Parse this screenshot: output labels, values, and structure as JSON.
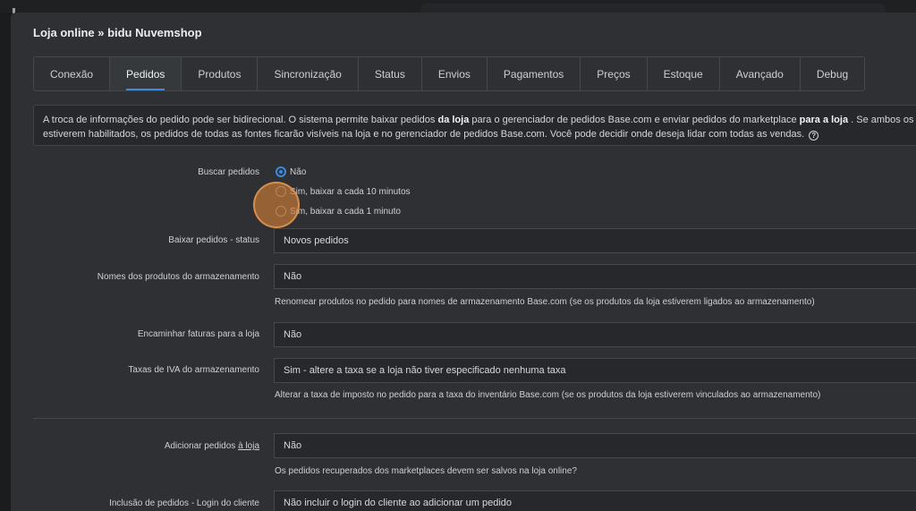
{
  "modal": {
    "title": "Loja online » bidu Nuvemshop"
  },
  "tabs": [
    {
      "label": "Conexão"
    },
    {
      "label": "Pedidos",
      "active": true
    },
    {
      "label": "Produtos"
    },
    {
      "label": "Sincronização"
    },
    {
      "label": "Status"
    },
    {
      "label": "Envios"
    },
    {
      "label": "Pagamentos"
    },
    {
      "label": "Preços"
    },
    {
      "label": "Estoque"
    },
    {
      "label": "Avançado"
    },
    {
      "label": "Debug"
    }
  ],
  "info": {
    "part1": "A troca de informações do pedido pode ser bidirecional. O sistema permite baixar pedidos ",
    "bold1": "da loja",
    "part2": " para o gerenciador de pedidos Base.com e enviar pedidos do marketplace ",
    "bold2": "para a loja",
    "part3": " . Se ambos os re",
    "line2": "estiverem habilitados, os pedidos de todas as fontes ficarão visíveis na loja e no gerenciador de pedidos Base.com. Você pode decidir onde deseja lidar com todas as vendas.",
    "help_glyph": "?"
  },
  "fetch_orders": {
    "label": "Buscar pedidos",
    "options": [
      {
        "label": "Não",
        "checked": true
      },
      {
        "label": "Sim, baixar a cada 10 minutos",
        "checked": false
      },
      {
        "label": "Sim, baixar a cada 1 minuto",
        "checked": false
      }
    ]
  },
  "download_status": {
    "label": "Baixar pedidos - status",
    "value": "Novos pedidos"
  },
  "product_names": {
    "label": "Nomes dos produtos do armazenamento",
    "value": "Não",
    "hint": "Renomear produtos no pedido para nomes de armazenamento Base.com (se os produtos da loja estiverem ligados ao armazenamento)"
  },
  "forward_invoices": {
    "label": "Encaminhar faturas para a loja",
    "value": "Não"
  },
  "vat_rates": {
    "label": "Taxas de IVA do armazenamento",
    "value": "Sim - altere a taxa se a loja não tiver especificado nenhuma taxa",
    "hint": "Alterar a taxa de imposto no pedido para a taxa do inventário Base.com (se os produtos da loja estiverem vinculados ao armazenamento)"
  },
  "add_orders": {
    "label_prefix": "Adicionar pedidos ",
    "label_link": "à loja",
    "value": "Não",
    "hint": "Os pedidos recuperados dos marketplaces devem ser salvos na loja online?"
  },
  "customer_login": {
    "label": "Inclusão de pedidos - Login do cliente",
    "value": "Não incluir o login do cliente ao adicionar um pedido"
  }
}
